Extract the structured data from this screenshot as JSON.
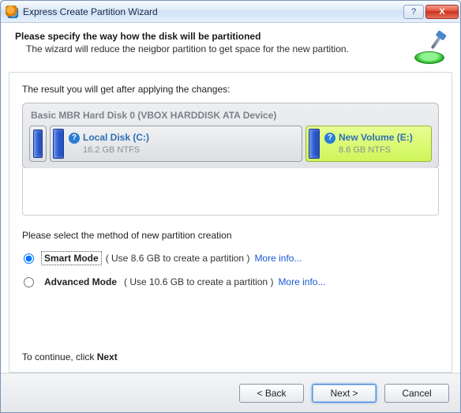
{
  "window": {
    "title": "Express Create Partition Wizard"
  },
  "header": {
    "heading": "Please specify the way how the disk will be partitioned",
    "sub": "The wizard will reduce the neigbor partition to get space for the new partition."
  },
  "result_label": "The result you will get after applying the changes:",
  "disk": {
    "title": "Basic MBR Hard Disk 0 (VBOX HARDDISK ATA Device)",
    "partitions": {
      "local": {
        "name": "Local Disk (C:)",
        "size": "16.2 GB NTFS"
      },
      "new": {
        "name": "New Volume (E:)",
        "size": "8.6 GB NTFS"
      }
    }
  },
  "method_label": "Please select the method of new partition creation",
  "modes": {
    "smart": {
      "name": "Smart Mode",
      "desc": "( Use 8.6 GB to create a partition )",
      "more": "More info...",
      "checked": true
    },
    "advanced": {
      "name": "Advanced Mode",
      "desc": "( Use 10.6 GB to create a partition )",
      "more": "More info...",
      "checked": false
    }
  },
  "continue_prefix": "To continue, click ",
  "continue_action": "Next",
  "buttons": {
    "back": "< Back",
    "next": "Next >",
    "cancel": "Cancel"
  },
  "titlebar": {
    "help": "?",
    "close": "X"
  }
}
